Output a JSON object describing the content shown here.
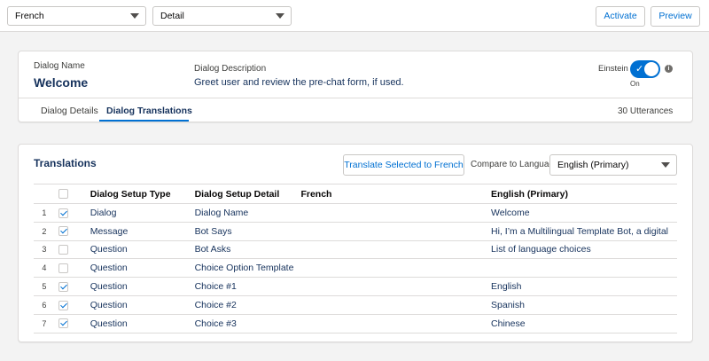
{
  "toolbar": {
    "language_select": "French",
    "view_select": "Detail",
    "activate_label": "Activate",
    "preview_label": "Preview"
  },
  "dialog": {
    "name_label": "Dialog Name",
    "name": "Welcome",
    "description_label": "Dialog Description",
    "description": "Greet user and review the pre-chat form, if used.",
    "einstein_label": "Einstein",
    "einstein_state": "On",
    "tabs": [
      {
        "label": "Dialog Details",
        "active": false
      },
      {
        "label": "Dialog Translations",
        "active": true
      }
    ],
    "utterances": "30 Utterances"
  },
  "translations": {
    "title": "Translations",
    "translate_button": "Translate Selected to French",
    "compare_label": "Compare to Language",
    "compare_value": "English (Primary)",
    "columns": [
      "Dialog Setup Type",
      "Dialog Setup Detail",
      "French",
      "English (Primary)"
    ],
    "rows": [
      {
        "num": "1",
        "checked": true,
        "type": "Dialog",
        "detail": "Dialog Name",
        "french": "",
        "english": "Welcome"
      },
      {
        "num": "2",
        "checked": true,
        "type": "Message",
        "detail": "Bot Says",
        "french": "",
        "english": "Hi, I’m a Multilingual Template Bot, a digital"
      },
      {
        "num": "3",
        "checked": false,
        "type": "Question",
        "detail": "Bot Asks",
        "french": "",
        "english": "List of language choices"
      },
      {
        "num": "4",
        "checked": false,
        "type": "Question",
        "detail": "Choice Option Template",
        "french": "",
        "english": ""
      },
      {
        "num": "5",
        "checked": true,
        "type": "Question",
        "detail": "Choice #1",
        "french": "",
        "english": "English"
      },
      {
        "num": "6",
        "checked": true,
        "type": "Question",
        "detail": "Choice #2",
        "french": "",
        "english": "Spanish"
      },
      {
        "num": "7",
        "checked": true,
        "type": "Question",
        "detail": "Choice #3",
        "french": "",
        "english": "Chinese"
      }
    ]
  },
  "colors": {
    "accent": "#0070d2",
    "title_text": "#16325c",
    "background": "#f3f3f3"
  }
}
